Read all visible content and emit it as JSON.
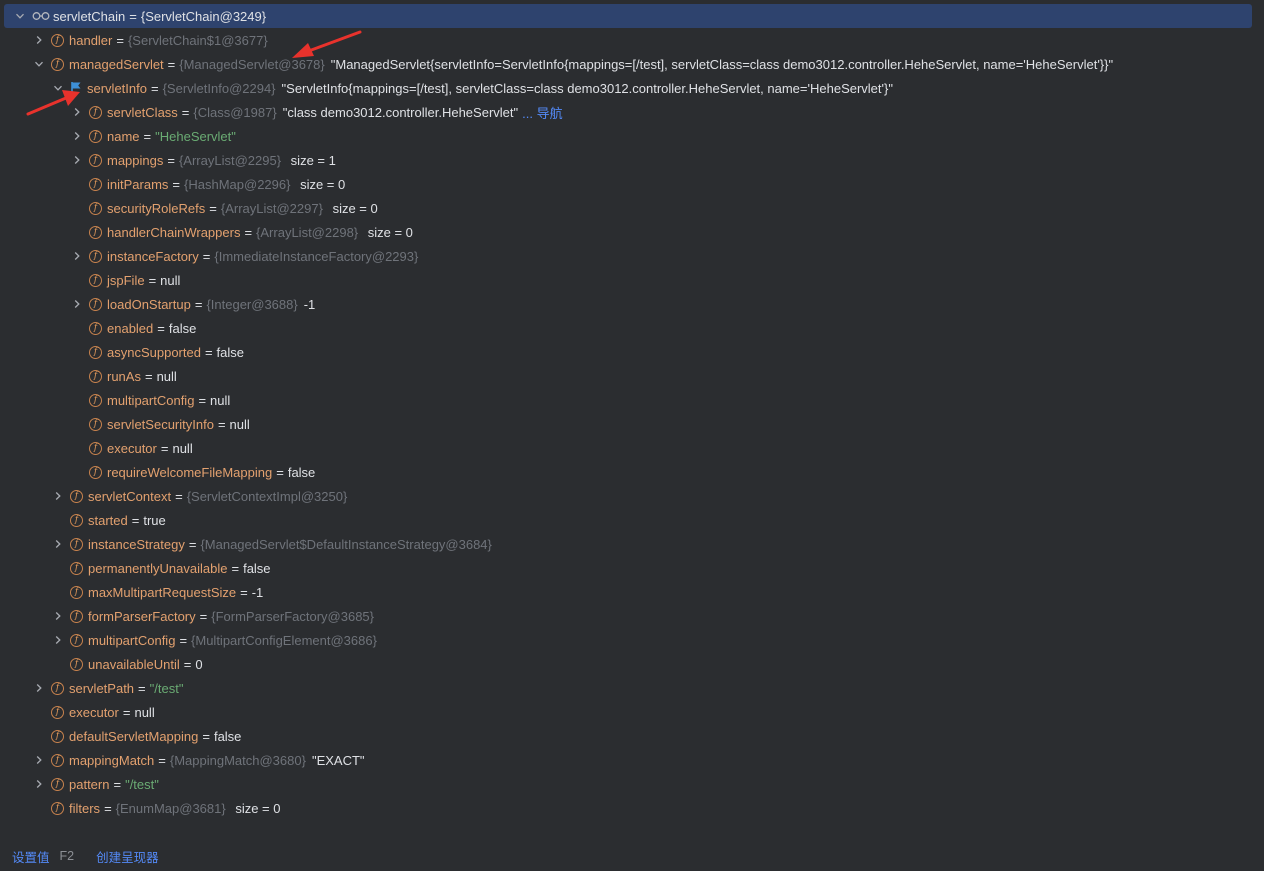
{
  "tree": [
    {
      "depth": 0,
      "arrow": "down",
      "icon": "glasses",
      "name": "servletChain",
      "ref": "{ServletChain@3249}",
      "selected": true
    },
    {
      "depth": 1,
      "arrow": "right",
      "icon": "field",
      "name": "handler",
      "ref": "{ServletChain$1@3677}"
    },
    {
      "depth": 1,
      "arrow": "down",
      "icon": "field",
      "name": "managedServlet",
      "ref": "{ManagedServlet@3678}",
      "value": "\"ManagedServlet{servletInfo=ServletInfo{mappings=[/test], servletClass=class demo3012.controller.HeheServlet, name='HeheServlet'}}\""
    },
    {
      "depth": 2,
      "arrow": "down",
      "icon": "flag",
      "name": "servletInfo",
      "ref": "{ServletInfo@2294}",
      "value": "\"ServletInfo{mappings=[/test], servletClass=class demo3012.controller.HeheServlet, name='HeheServlet'}\""
    },
    {
      "depth": 3,
      "arrow": "right",
      "icon": "field",
      "name": "servletClass",
      "ref": "{Class@1987}",
      "value": "\"class demo3012.controller.HeheServlet\"",
      "link": "... 导航"
    },
    {
      "depth": 3,
      "arrow": "right",
      "icon": "field",
      "name": "name",
      "string": "\"HeheServlet\""
    },
    {
      "depth": 3,
      "arrow": "right",
      "icon": "field",
      "name": "mappings",
      "ref": "{ArrayList@2295}",
      "value": " size = 1"
    },
    {
      "depth": 3,
      "arrow": "none",
      "icon": "field",
      "name": "initParams",
      "ref": "{HashMap@2296}",
      "value": " size = 0"
    },
    {
      "depth": 3,
      "arrow": "none",
      "icon": "field",
      "name": "securityRoleRefs",
      "ref": "{ArrayList@2297}",
      "value": " size = 0"
    },
    {
      "depth": 3,
      "arrow": "none",
      "icon": "field",
      "name": "handlerChainWrappers",
      "ref": "{ArrayList@2298}",
      "value": " size = 0"
    },
    {
      "depth": 3,
      "arrow": "right",
      "icon": "field",
      "name": "instanceFactory",
      "ref": "{ImmediateInstanceFactory@2293}"
    },
    {
      "depth": 3,
      "arrow": "none",
      "icon": "field",
      "name": "jspFile",
      "plain": "null"
    },
    {
      "depth": 3,
      "arrow": "right",
      "icon": "field",
      "name": "loadOnStartup",
      "ref": "{Integer@3688}",
      "value": "-1"
    },
    {
      "depth": 3,
      "arrow": "none",
      "icon": "field",
      "name": "enabled",
      "plain": "false"
    },
    {
      "depth": 3,
      "arrow": "none",
      "icon": "field",
      "name": "asyncSupported",
      "plain": "false"
    },
    {
      "depth": 3,
      "arrow": "none",
      "icon": "field",
      "name": "runAs",
      "plain": "null"
    },
    {
      "depth": 3,
      "arrow": "none",
      "icon": "field",
      "name": "multipartConfig",
      "plain": "null"
    },
    {
      "depth": 3,
      "arrow": "none",
      "icon": "field",
      "name": "servletSecurityInfo",
      "plain": "null"
    },
    {
      "depth": 3,
      "arrow": "none",
      "icon": "field",
      "name": "executor",
      "plain": "null"
    },
    {
      "depth": 3,
      "arrow": "none",
      "icon": "field",
      "name": "requireWelcomeFileMapping",
      "plain": "false"
    },
    {
      "depth": 2,
      "arrow": "right",
      "icon": "field",
      "name": "servletContext",
      "ref": "{ServletContextImpl@3250}"
    },
    {
      "depth": 2,
      "arrow": "none",
      "icon": "field",
      "name": "started",
      "plain": "true"
    },
    {
      "depth": 2,
      "arrow": "right",
      "icon": "field",
      "name": "instanceStrategy",
      "ref": "{ManagedServlet$DefaultInstanceStrategy@3684}"
    },
    {
      "depth": 2,
      "arrow": "none",
      "icon": "field",
      "name": "permanentlyUnavailable",
      "plain": "false"
    },
    {
      "depth": 2,
      "arrow": "none",
      "icon": "field",
      "name": "maxMultipartRequestSize",
      "plain": "-1"
    },
    {
      "depth": 2,
      "arrow": "right",
      "icon": "field",
      "name": "formParserFactory",
      "ref": "{FormParserFactory@3685}"
    },
    {
      "depth": 2,
      "arrow": "right",
      "icon": "field",
      "name": "multipartConfig",
      "ref": "{MultipartConfigElement@3686}"
    },
    {
      "depth": 2,
      "arrow": "none",
      "icon": "field",
      "name": "unavailableUntil",
      "plain": "0"
    },
    {
      "depth": 1,
      "arrow": "right",
      "icon": "field",
      "name": "servletPath",
      "string": "\"/test\""
    },
    {
      "depth": 1,
      "arrow": "none",
      "icon": "field",
      "name": "executor",
      "plain": "null"
    },
    {
      "depth": 1,
      "arrow": "none",
      "icon": "field",
      "name": "defaultServletMapping",
      "plain": "false"
    },
    {
      "depth": 1,
      "arrow": "right",
      "icon": "field",
      "name": "mappingMatch",
      "ref": "{MappingMatch@3680}",
      "value": "\"EXACT\""
    },
    {
      "depth": 1,
      "arrow": "right",
      "icon": "field",
      "name": "pattern",
      "string": "\"/test\""
    },
    {
      "depth": 1,
      "arrow": "none",
      "icon": "field",
      "name": "filters",
      "ref": "{EnumMap@3681}",
      "value": " size = 0"
    }
  ],
  "eq_sign": "=",
  "field_glyph": "f",
  "bottom": {
    "set_value": "设置值",
    "set_value_key": "F2",
    "create_renderer": "创建呈现器"
  },
  "colors": {
    "background": "#2b2d30",
    "selection": "#2e436e",
    "field_name": "#e3a16f",
    "reference": "#6f737a",
    "string": "#6aab73",
    "link": "#548af7",
    "annotation_arrow": "#e8322c"
  }
}
